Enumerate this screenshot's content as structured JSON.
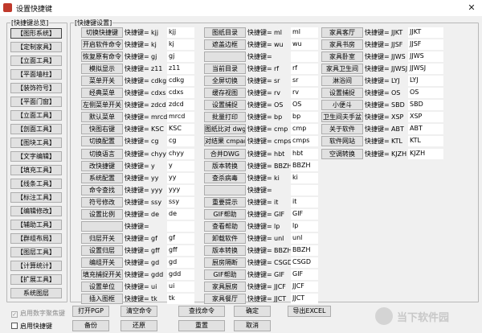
{
  "window": {
    "title": "设置快捷键",
    "close_glyph": "✕"
  },
  "category_group": {
    "title": "[快捷键总览]",
    "items": [
      {
        "label": "【图形系统】",
        "selected": true
      },
      {
        "label": "【定制家具】"
      },
      {
        "label": "【立面工具】"
      },
      {
        "label": "【平面墙柱】"
      },
      {
        "label": "【装饰符号】"
      },
      {
        "label": "【平面门窗】"
      },
      {
        "label": "【立面工具】"
      },
      {
        "label": "【剖面工具】"
      },
      {
        "label": "【图块工具】"
      },
      {
        "label": "【文字编辑】"
      },
      {
        "label": "【填充工具】"
      },
      {
        "label": "【线条工具】"
      },
      {
        "label": "【标注工具】"
      },
      {
        "label": "【编辑修改】"
      },
      {
        "label": "【辅助工具】"
      },
      {
        "label": "【群组布局】"
      },
      {
        "label": "【图层工具】"
      },
      {
        "label": "【计算统计】"
      },
      {
        "label": "【扩展工具】"
      },
      {
        "label": "系统图层"
      }
    ]
  },
  "settings_group": {
    "title": "[快捷键设置]",
    "shortcut_prefix": "快捷键=",
    "columns": [
      [
        {
          "name": "切换快捷键",
          "code": "kjj",
          "value": "kjj"
        },
        {
          "name": "开启软件命令",
          "code": "kj",
          "value": "kj"
        },
        {
          "name": "恢复原有命令",
          "code": "gj",
          "value": "gj"
        },
        {
          "name": "模拟显示",
          "code": "z11",
          "value": "z11"
        },
        {
          "name": "菜单开关",
          "code": "cdkg",
          "value": "cdkg"
        },
        {
          "name": "经典菜单",
          "code": "cdxs",
          "value": "cdxs"
        },
        {
          "name": "左侧菜单开关",
          "code": "zdcd",
          "value": "zdcd"
        },
        {
          "name": "默认菜单",
          "code": "mrcd",
          "value": "mrcd"
        },
        {
          "name": "快图右键",
          "code": "KSC",
          "value": "KSC"
        },
        {
          "name": "切换配置",
          "code": "cg",
          "value": "cg"
        },
        {
          "name": "切换语言",
          "code": "chyy",
          "value": "chyy"
        },
        {
          "name": "改快捷键",
          "code": "y",
          "value": "y"
        },
        {
          "name": "系统配置",
          "code": "yy",
          "value": "yy"
        },
        {
          "name": "命令查找",
          "code": "yyy",
          "value": "yyy"
        },
        {
          "name": "符号修改",
          "code": "ssy",
          "value": "ssy"
        },
        {
          "name": "设置比例",
          "code": "de",
          "value": "de"
        },
        {
          "name": "",
          "code": "",
          "value": ""
        },
        {
          "name": "归层开关",
          "code": "gf",
          "value": "gf"
        },
        {
          "name": "设置归层",
          "code": "gff",
          "value": "gff"
        },
        {
          "name": "编组开关",
          "code": "gd",
          "value": "gd"
        },
        {
          "name": "填充捕捉开关",
          "code": "gdd",
          "value": "gdd"
        },
        {
          "name": "设置单位",
          "code": "ui",
          "value": "ui"
        },
        {
          "name": "插入图框",
          "code": "tk",
          "value": "tk"
        }
      ],
      [
        {
          "name": "图纸目录",
          "code": "ml",
          "value": "ml"
        },
        {
          "name": "遮盖边框",
          "code": "wu",
          "value": "wu"
        },
        {
          "name": "",
          "code": "",
          "value": ""
        },
        {
          "name": "当前目录",
          "code": "rf",
          "value": "rf"
        },
        {
          "name": "全屏切换",
          "code": "sr",
          "value": "sr"
        },
        {
          "name": "缓存视图",
          "code": "rv",
          "value": "rv"
        },
        {
          "name": "设置捕捉",
          "code": "OS",
          "value": "OS"
        },
        {
          "name": "批量打印",
          "code": "bp",
          "value": "bp"
        },
        {
          "name": "图纸比对 dwg cmpare",
          "code": "cmp",
          "value": "cmp"
        },
        {
          "name": "对结果 cmpare resu",
          "code": "cmps",
          "value": "cmps"
        },
        {
          "name": "合并DWG",
          "code": "hbt",
          "value": "hbt"
        },
        {
          "name": "版本转换",
          "code": "BBZH",
          "value": "BBZH"
        },
        {
          "name": "查杀病毒",
          "code": "ki",
          "value": "ki"
        },
        {
          "name": "",
          "code": "",
          "value": ""
        },
        {
          "name": "重要提示",
          "code": "it",
          "value": "it"
        },
        {
          "name": "GIF帮助",
          "code": "GIF",
          "value": "GIF"
        },
        {
          "name": "查看帮助",
          "code": "lp",
          "value": "lp"
        },
        {
          "name": "卸载软件",
          "code": "unl",
          "value": "unl"
        },
        {
          "name": "版本转换",
          "code": "BBZH",
          "value": "BBZH"
        },
        {
          "name": "厨房隔断",
          "code": "CSGD",
          "value": "CSGD"
        },
        {
          "name": "GIF帮助",
          "code": "GIF",
          "value": "GIF"
        },
        {
          "name": "家具厨房",
          "code": "JJCF",
          "value": "JJCF"
        },
        {
          "name": "家具餐厅",
          "code": "JJCT",
          "value": "JJCT"
        }
      ],
      [
        {
          "name": "家具客厅",
          "code": "JJKT",
          "value": "JJKT"
        },
        {
          "name": "家具书房",
          "code": "JJSF",
          "value": "JJSF"
        },
        {
          "name": "家具卧室",
          "code": "JJWS",
          "value": "JJWS"
        },
        {
          "name": "家具卫生间",
          "code": "JJWSJ",
          "value": "JJWSJ"
        },
        {
          "name": "淋浴间",
          "code": "LYJ",
          "value": "LYJ"
        },
        {
          "name": "设置捕捉",
          "code": "OS",
          "value": "OS"
        },
        {
          "name": "小便斗",
          "code": "SBD",
          "value": "SBD"
        },
        {
          "name": "卫生间夫手盆",
          "code": "XSP",
          "value": "XSP"
        },
        {
          "name": "关于软件",
          "code": "ABT",
          "value": "ABT"
        },
        {
          "name": "软件网站",
          "code": "KTL",
          "value": "KTL"
        },
        {
          "name": "空调转换",
          "code": "KJZH",
          "value": "KJZH"
        }
      ]
    ]
  },
  "bottom": {
    "checkboxes": [
      {
        "label": "启用数字聚焦键",
        "disabled": true,
        "checked": true
      },
      {
        "label": "启用快捷键",
        "disabled": false,
        "checked": false
      }
    ],
    "row1": [
      "打开PGP",
      "清空命令",
      "查找命令",
      "确定",
      "导出EXCEL"
    ],
    "row2": [
      "备份",
      "还原",
      "重置",
      "取消"
    ]
  },
  "watermark": {
    "text": "当下软件园"
  }
}
